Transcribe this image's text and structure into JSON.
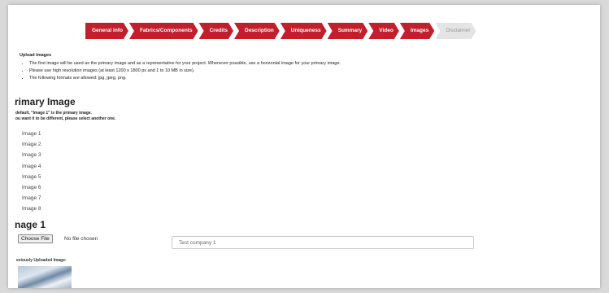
{
  "steps": [
    {
      "label": "General Info",
      "state": "done"
    },
    {
      "label": "Fabrics/Components",
      "state": "done"
    },
    {
      "label": "Credits",
      "state": "done"
    },
    {
      "label": "Description",
      "state": "done"
    },
    {
      "label": "Uniqueness",
      "state": "done"
    },
    {
      "label": "Summary",
      "state": "done"
    },
    {
      "label": "Video",
      "state": "done"
    },
    {
      "label": "Images",
      "state": "current"
    },
    {
      "label": "Disclaimer",
      "state": "upcoming"
    }
  ],
  "colors": {
    "accent": "#c21f2d",
    "inactive_step": "#e4e4e4"
  },
  "upload": {
    "heading": "Upload Images",
    "bullets": [
      "The first image will be used as the primary image and as a representative for your project. Whenever possible, use a horizontal image for your primary image.",
      "Please use high resolution images (at least 1200 x 1800 px and 1 to 10 MB in size).",
      "The following formats are allowed: jpg, jpeg, png."
    ]
  },
  "primary": {
    "heading": "rimary Image",
    "note_line1": "default, \"Image 1\" is the primary image.",
    "note_line2": "ou want it to be different, please select another one.",
    "options": [
      "Image 1",
      "Image 2",
      "Image 3",
      "Image 4",
      "Image 5",
      "Image 6",
      "Image 7",
      "Image 8"
    ]
  },
  "image1": {
    "heading": "nage 1",
    "choose_file_label": "Choose File",
    "file_status": "No file chosen",
    "text_value": "Test company 1",
    "previous_label": "eviously Uploaded Image:"
  }
}
